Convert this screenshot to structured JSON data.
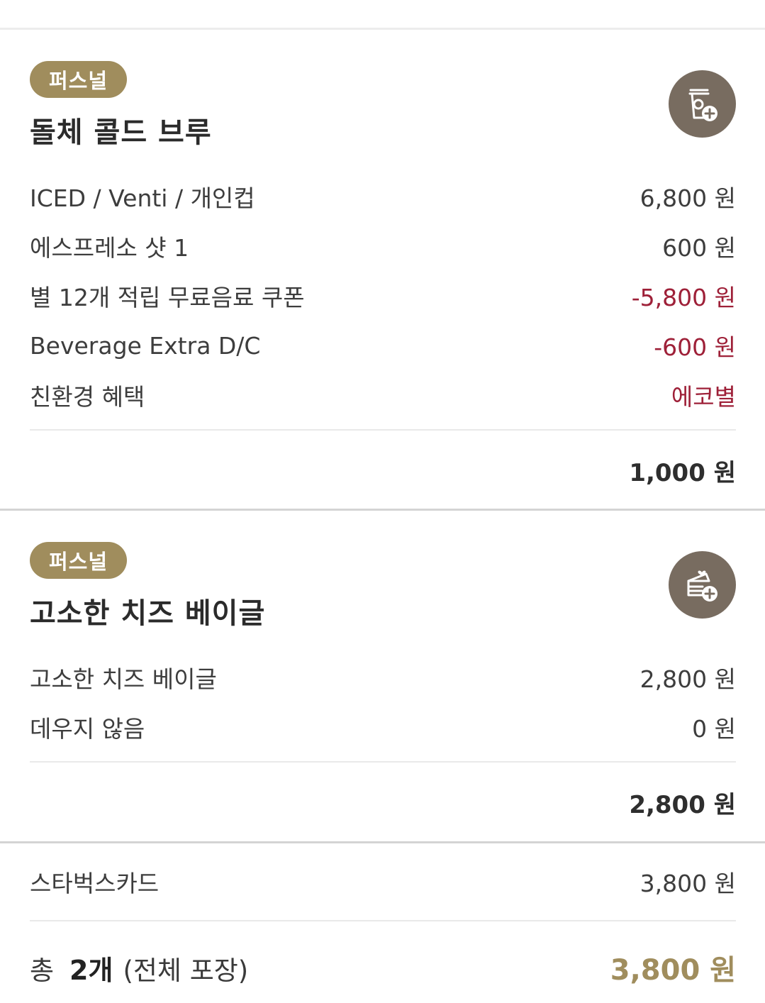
{
  "items": [
    {
      "badge": "퍼스널",
      "name": "돌체 콜드 브루",
      "icon": "cup-plus-icon",
      "lines": [
        {
          "label": "ICED / Venti / 개인컵",
          "value": "6,800 원",
          "negative": false
        },
        {
          "label": "에스프레소 샷 1",
          "value": "600 원",
          "negative": false
        },
        {
          "label": "별 12개 적립 무료음료 쿠폰",
          "value": "-5,800 원",
          "negative": true
        },
        {
          "label": "Beverage Extra D/C",
          "value": "-600 원",
          "negative": true
        },
        {
          "label": "친환경 혜택",
          "value": "에코별",
          "negative": true
        }
      ],
      "subtotal": "1,000 원"
    },
    {
      "badge": "퍼스널",
      "name": "고소한 치즈 베이글",
      "icon": "cake-plus-icon",
      "lines": [
        {
          "label": "고소한 치즈 베이글",
          "value": "2,800 원",
          "negative": false
        },
        {
          "label": "데우지 않음",
          "value": "0 원",
          "negative": false
        }
      ],
      "subtotal": "2,800 원"
    }
  ],
  "payment": {
    "method": "스타벅스카드",
    "amount": "3,800 원"
  },
  "total": {
    "prefix": "총",
    "count": "2개",
    "packaging": "(전체 포장)",
    "amount": "3,800 원"
  },
  "colors": {
    "badge": "#a08d5d",
    "negative": "#9e2038",
    "icon_bg": "#786c60",
    "total_amount": "#a08d5d"
  }
}
